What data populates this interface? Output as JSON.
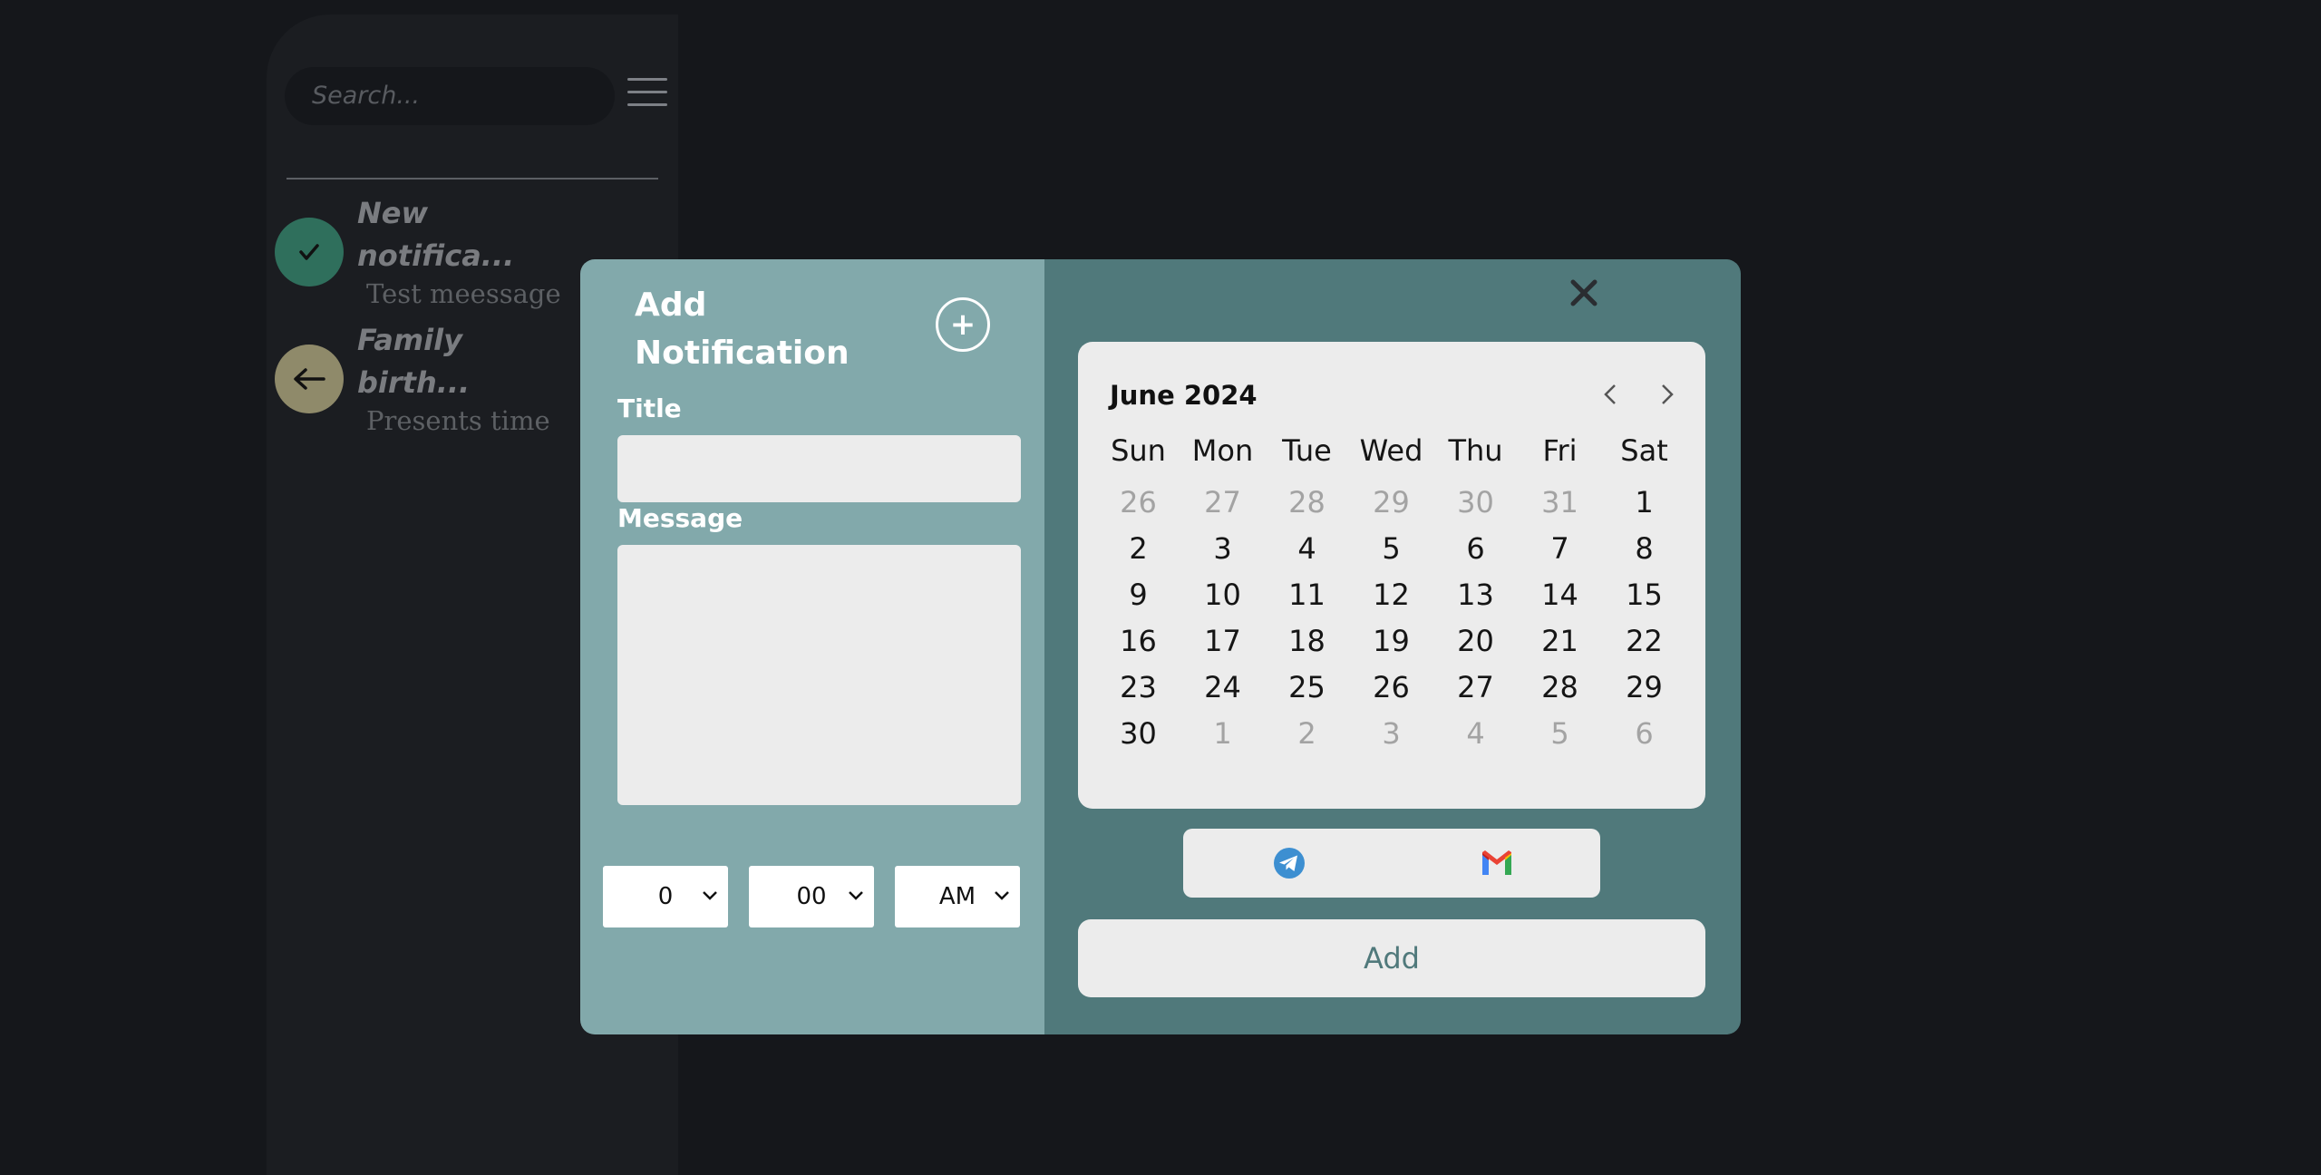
{
  "sidebar": {
    "search_placeholder": "Search...",
    "notifications": [
      {
        "title": "New notifica...",
        "message": "Test meessage",
        "icon": "check-icon",
        "color": "#2f6f5c"
      },
      {
        "title": "Family birth...",
        "message": "Presents time",
        "icon": "arrow-left-icon",
        "color": "#8f8a6a"
      }
    ]
  },
  "modal": {
    "title": "Add\nNotification",
    "title_label": "Title",
    "title_value": "",
    "message_label": "Message",
    "message_value": "",
    "time": {
      "hour": "0",
      "minute": "00",
      "period": "AM"
    },
    "add_button": "Add",
    "colors": {
      "left_panel": "#82a9ab",
      "right_panel": "#50797b"
    }
  },
  "calendar": {
    "month_label": "June 2024",
    "weekdays": [
      "Sun",
      "Mon",
      "Tue",
      "Wed",
      "Thu",
      "Fri",
      "Sat"
    ],
    "weeks": [
      [
        "26",
        "27",
        "28",
        "29",
        "30",
        "31",
        "1"
      ],
      [
        "2",
        "3",
        "4",
        "5",
        "6",
        "7",
        "8"
      ],
      [
        "9",
        "10",
        "11",
        "12",
        "13",
        "14",
        "15"
      ],
      [
        "16",
        "17",
        "18",
        "19",
        "20",
        "21",
        "22"
      ],
      [
        "23",
        "24",
        "25",
        "26",
        "27",
        "28",
        "29"
      ],
      [
        "30",
        "1",
        "2",
        "3",
        "4",
        "5",
        "6"
      ]
    ]
  }
}
